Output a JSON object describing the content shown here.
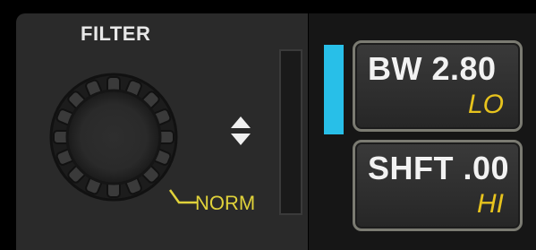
{
  "filter": {
    "title": "FILTER",
    "mode_label": "NORM"
  },
  "controls": {
    "bandwidth": {
      "main_label": "BW 2.80",
      "sub_label": "LO"
    },
    "shift": {
      "main_label": "SHFT .00",
      "sub_label": "HI"
    }
  },
  "colors": {
    "accent_indicator": "#28bfe8",
    "mode_text": "#e0d23a",
    "sub_label_text": "#e7c31d",
    "panel_bg": "#2a2a2a"
  },
  "icons": {
    "knob": "filter-knob",
    "arrows": "up-down-arrows-icon"
  }
}
